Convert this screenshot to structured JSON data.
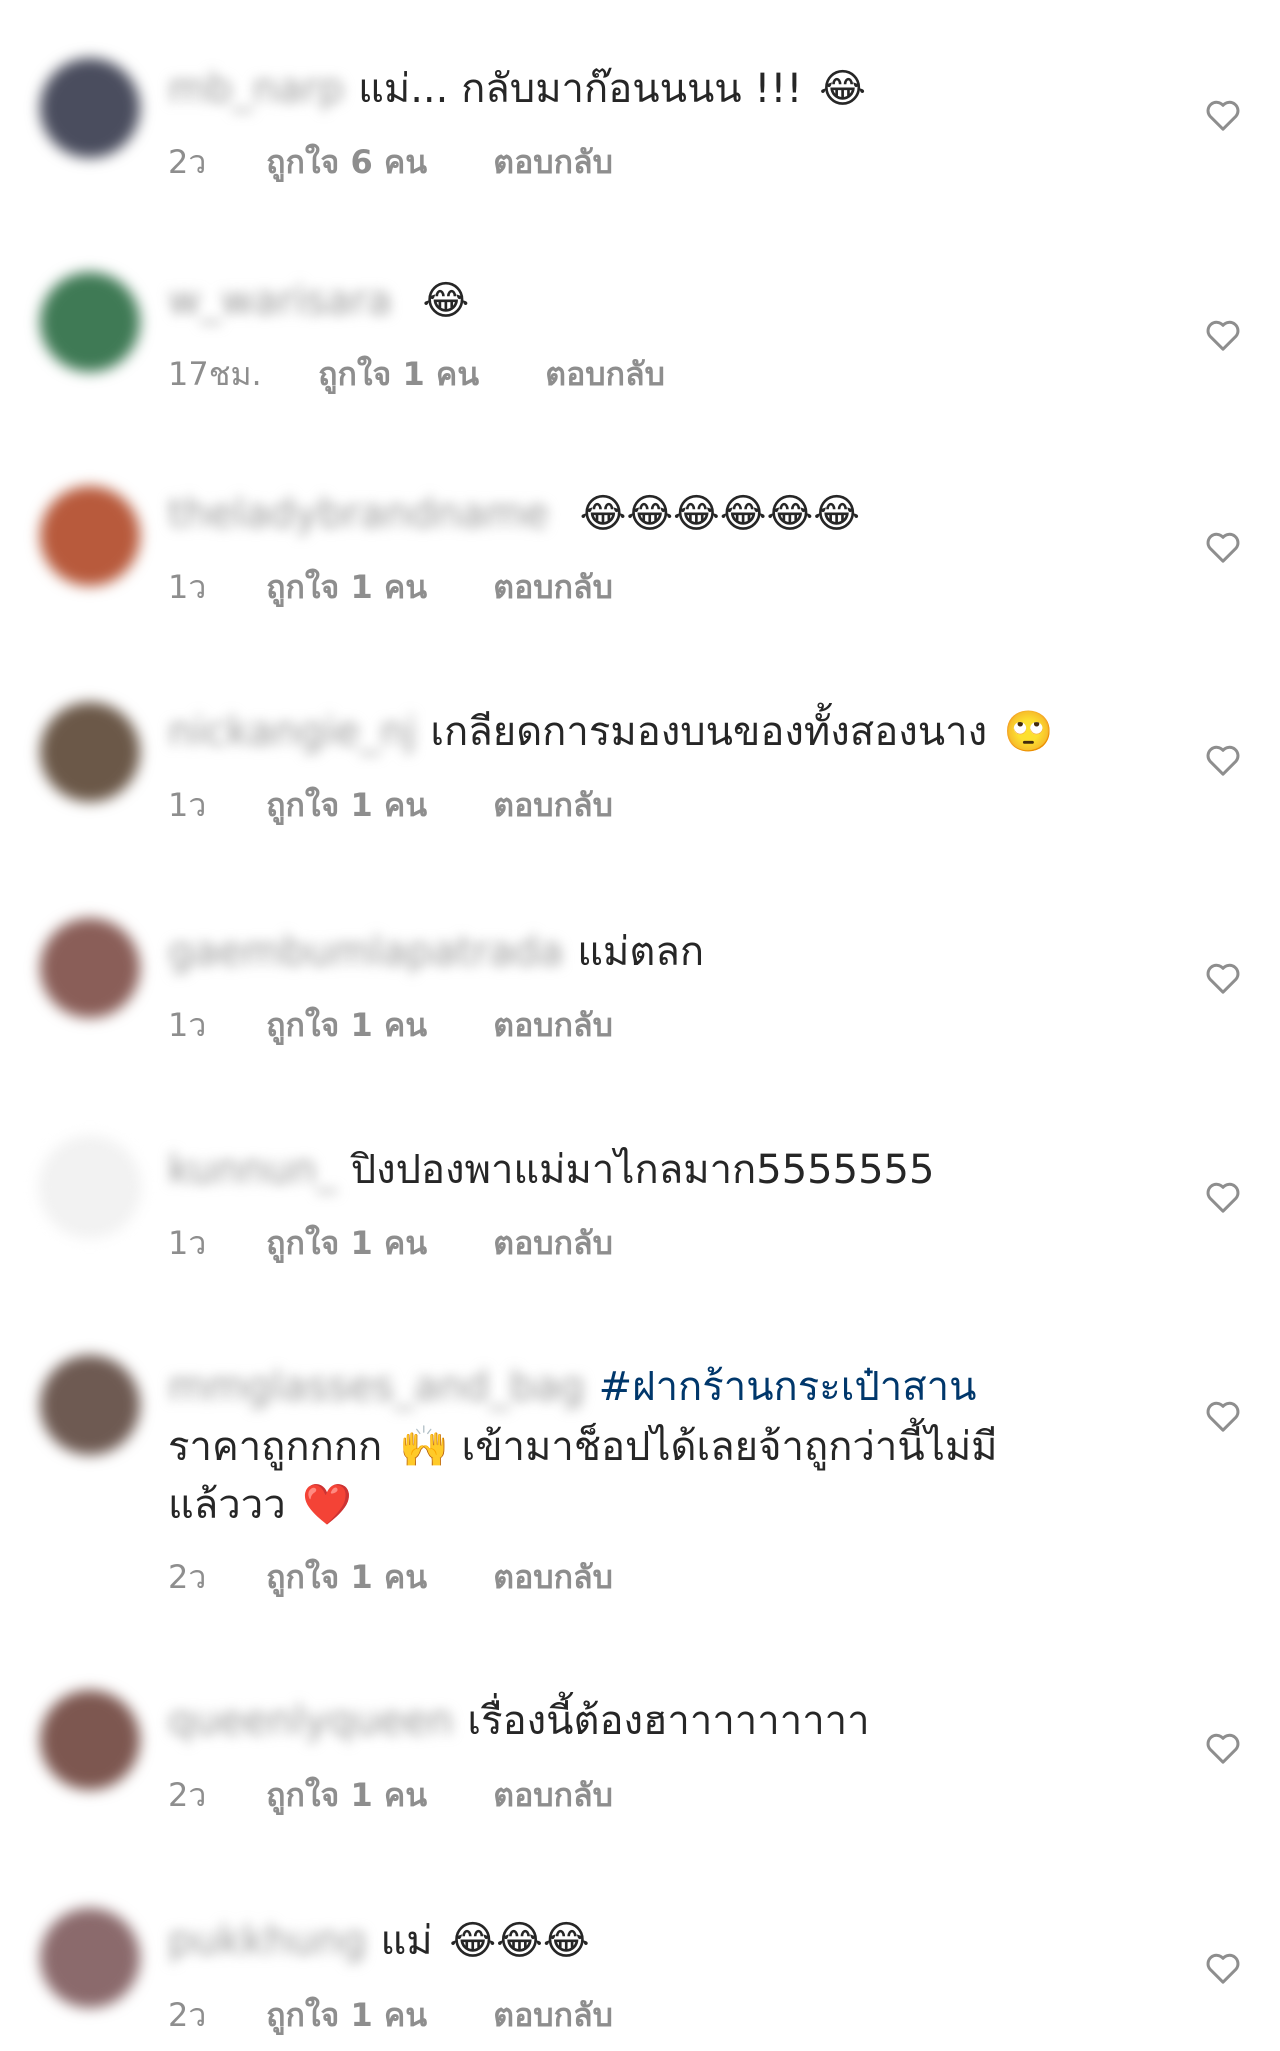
{
  "comments": [
    {
      "username": "mb_narp",
      "text": "แม่... กลับมาก๊อนนนน !!!",
      "emoji": "😂",
      "time": "2ว",
      "likes": "ถูกใจ 6 คน",
      "reply": "ตอบกลับ",
      "avatar_color": "#4a4d5e"
    },
    {
      "username": "w_warisara",
      "text": "",
      "emoji": "😂",
      "time": "17ชม.",
      "likes": "ถูกใจ 1 คน",
      "reply": "ตอบกลับ",
      "avatar_color": "#3f7a55"
    },
    {
      "username": "theladybrandname",
      "text": "",
      "emoji": "😂😂😂😂😂😂",
      "time": "1ว",
      "likes": "ถูกใจ 1 คน",
      "reply": "ตอบกลับ",
      "avatar_color": "#b85a3c"
    },
    {
      "username": "nickangie_nj",
      "text": "เกลียดการมองบนของทั้งสองนาง",
      "emoji": "🙄",
      "time": "1ว",
      "likes": "ถูกใจ 1 คน",
      "reply": "ตอบกลับ",
      "avatar_color": "#6b5848"
    },
    {
      "username": "gaembumlapatrada",
      "text": "แม่ตลก",
      "emoji": "",
      "time": "1ว",
      "likes": "ถูกใจ 1 คน",
      "reply": "ตอบกลับ",
      "avatar_color": "#8a5e58"
    },
    {
      "username": "kunnun_",
      "text": "ปิงปองพาแม่มาไกลมาก5555555",
      "emoji": "",
      "time": "1ว",
      "likes": "ถูกใจ 1 คน",
      "reply": "ตอบกลับ",
      "avatar_color": "#f2f2f2"
    },
    {
      "username": "mmglasses_and_bag",
      "hashtag": "#ฝากร้านกระเป๋าสาน",
      "text_line2": "ราคาถูกกกก",
      "emoji_line2": "🙌",
      "text_line2b": "เข้ามาช็อปได้เลยจ้าถูกว่านี้ไม่มี",
      "text_line3": "แล้ววว",
      "emoji_line3": "❤️",
      "time": "2ว",
      "likes": "ถูกใจ 1 คน",
      "reply": "ตอบกลับ",
      "avatar_color": "#6e5a52"
    },
    {
      "username": "queenlyqueen",
      "text": "เรื่องนี้ต้องฮาาาาาาาาา",
      "emoji": "",
      "time": "2ว",
      "likes": "ถูกใจ 1 คน",
      "reply": "ตอบกลับ",
      "avatar_color": "#7d5750"
    },
    {
      "username": "pukkhung",
      "text": "แม่",
      "emoji": "😂😂😂",
      "time": "2ว",
      "likes": "ถูกใจ 1 คน",
      "reply": "ตอบกลับ",
      "avatar_color": "#8b6a6c"
    }
  ]
}
